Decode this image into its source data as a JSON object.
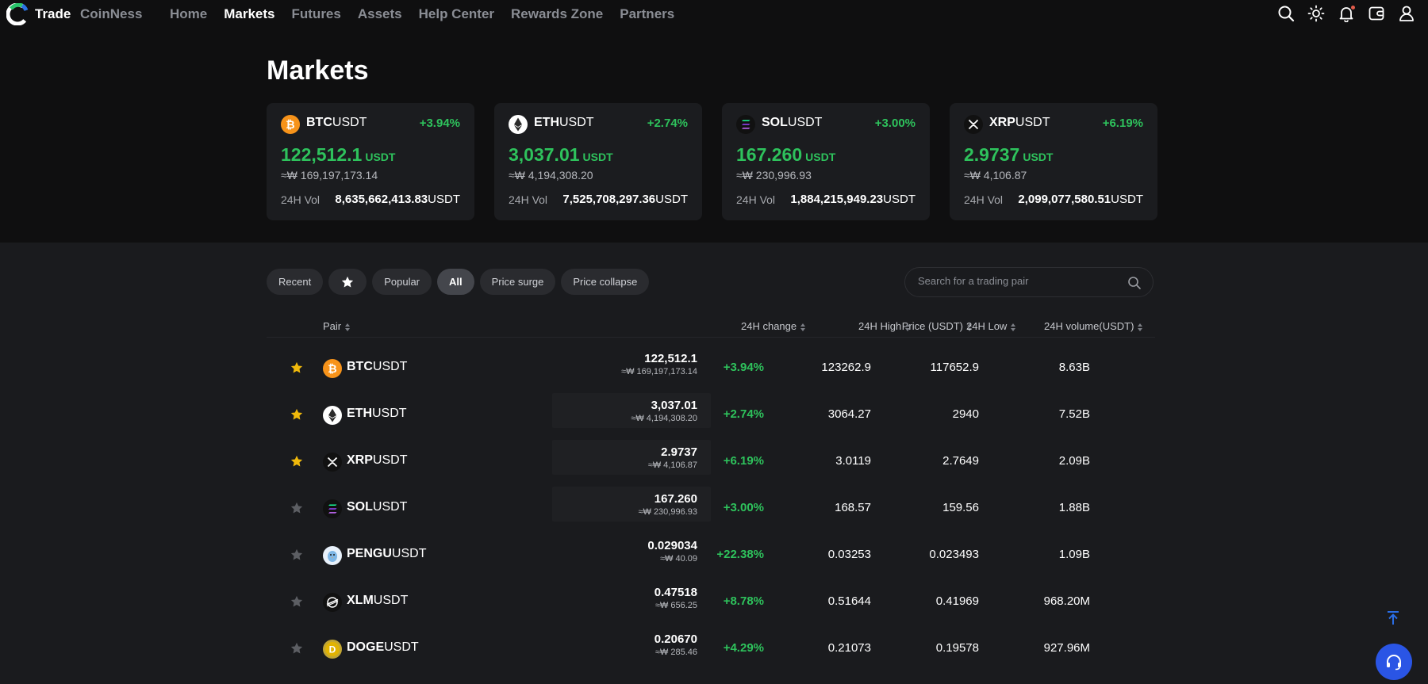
{
  "nav": {
    "brand": "Trade",
    "brand2": "CoinNess",
    "menu": [
      "Home",
      "Markets",
      "Futures",
      "Assets",
      "Help Center",
      "Rewards Zone",
      "Partners"
    ],
    "active": "Markets"
  },
  "page_title": "Markets",
  "cards": [
    {
      "base": "BTC",
      "quote": "USDT",
      "change": "+3.94%",
      "price": "122,512.1",
      "price_unit": "USDT",
      "krw": "≈₩ 169,197,173.14",
      "vol_label": "24H Vol",
      "vol": "8,635,662,413.83",
      "vol_unit": "USDT",
      "icon": "btc-icon",
      "icon_color": "#f7931a"
    },
    {
      "base": "ETH",
      "quote": "USDT",
      "change": "+2.74%",
      "price": "3,037.01",
      "price_unit": "USDT",
      "krw": "≈₩ 4,194,308.20",
      "vol_label": "24H Vol",
      "vol": "7,525,708,297.36",
      "vol_unit": "USDT",
      "icon": "eth-icon",
      "icon_color": "#ffffff"
    },
    {
      "base": "SOL",
      "quote": "USDT",
      "change": "+3.00%",
      "price": "167.260",
      "price_unit": "USDT",
      "krw": "≈₩ 230,996.93",
      "vol_label": "24H Vol",
      "vol": "1,884,215,949.23",
      "vol_unit": "USDT",
      "icon": "sol-icon",
      "icon_color": "#111111"
    },
    {
      "base": "XRP",
      "quote": "USDT",
      "change": "+6.19%",
      "price": "2.9737",
      "price_unit": "USDT",
      "krw": "≈₩ 4,106.87",
      "vol_label": "24H Vol",
      "vol": "2,099,077,580.51",
      "vol_unit": "USDT",
      "icon": "xrp-icon",
      "icon_color": "#111111"
    }
  ],
  "filters": [
    "Recent",
    "Popular",
    "All",
    "Price surge",
    "Price collapse"
  ],
  "active_filter": "All",
  "search": {
    "placeholder": "Search for a trading pair"
  },
  "table": {
    "headers": {
      "pair": "Pair",
      "price": "Price (USDT)",
      "change": "24H change",
      "high": "24H High",
      "low": "24H Low",
      "volume": "24H volume(USDT)"
    },
    "rows": [
      {
        "starred": true,
        "base": "BTC",
        "quote": "USDT",
        "price": "122,512.1",
        "krw": "≈₩ 169,197,173.14",
        "change": "+3.94%",
        "high": "123262.9",
        "low": "117652.9",
        "volume": "8.63B",
        "icon": "btc-icon"
      },
      {
        "starred": true,
        "base": "ETH",
        "quote": "USDT",
        "price": "3,037.01",
        "krw": "≈₩ 4,194,308.20",
        "change": "+2.74%",
        "high": "3064.27",
        "low": "2940",
        "volume": "7.52B",
        "icon": "eth-icon"
      },
      {
        "starred": true,
        "base": "XRP",
        "quote": "USDT",
        "price": "2.9737",
        "krw": "≈₩ 4,106.87",
        "change": "+6.19%",
        "high": "3.0119",
        "low": "2.7649",
        "volume": "2.09B",
        "icon": "xrp-icon"
      },
      {
        "starred": false,
        "base": "SOL",
        "quote": "USDT",
        "price": "167.260",
        "krw": "≈₩ 230,996.93",
        "change": "+3.00%",
        "high": "168.57",
        "low": "159.56",
        "volume": "1.88B",
        "icon": "sol-icon"
      },
      {
        "starred": false,
        "base": "PENGU",
        "quote": "USDT",
        "price": "0.029034",
        "krw": "≈₩ 40.09",
        "change": "+22.38%",
        "high": "0.03253",
        "low": "0.023493",
        "volume": "1.09B",
        "icon": "pengu-icon"
      },
      {
        "starred": false,
        "base": "XLM",
        "quote": "USDT",
        "price": "0.47518",
        "krw": "≈₩ 656.25",
        "change": "+8.78%",
        "high": "0.51644",
        "low": "0.41969",
        "volume": "968.20M",
        "icon": "xlm-icon"
      },
      {
        "starred": false,
        "base": "DOGE",
        "quote": "USDT",
        "price": "0.20670",
        "krw": "≈₩ 285.46",
        "change": "+4.29%",
        "high": "0.21073",
        "low": "0.19578",
        "volume": "927.96M",
        "icon": "doge-icon"
      }
    ]
  },
  "colors": {
    "positive": "#2ec25c",
    "star_active": "#f0b90b",
    "accent": "#2a55e5"
  }
}
